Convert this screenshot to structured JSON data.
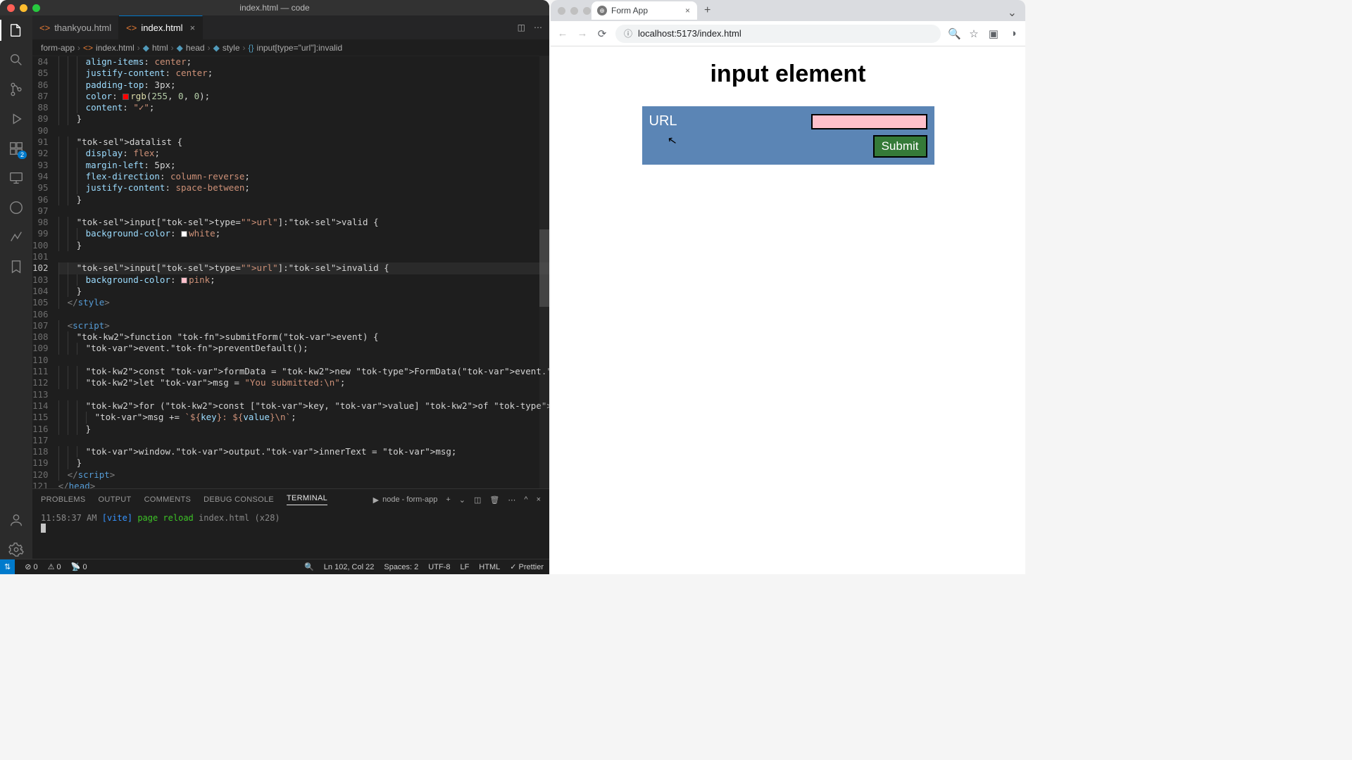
{
  "vscode": {
    "window_title": "index.html — code",
    "tabs": [
      {
        "label": "thankyou.html"
      },
      {
        "label": "index.html"
      }
    ],
    "tab_actions": {
      "split": "▯▯",
      "more": "⋯"
    },
    "breadcrumbs": {
      "items": [
        "form-app",
        "index.html",
        "html",
        "head",
        "style",
        "input[type=\"url\"]:invalid"
      ]
    },
    "code_lines": {
      "84": "      align-items: center;",
      "85": "      justify-content: center;",
      "86": "      padding-top: 3px;",
      "87": "      color: rgb(255, 0, 0);",
      "88": "      content: \"✓\";",
      "89": "    }",
      "90": "",
      "91": "    datalist {",
      "92": "      display: flex;",
      "93": "      margin-left: 5px;",
      "94": "      flex-direction: column-reverse;",
      "95": "      justify-content: space-between;",
      "96": "    }",
      "97": "",
      "98": "    input[type=\"url\"]:valid {",
      "99": "      background-color: white;",
      "100": "    }",
      "101": "",
      "102": "    input[type=\"url\"]:invalid {",
      "103": "      background-color: pink;",
      "104": "    }",
      "105": "  </style>",
      "106": "",
      "107": "  <script>",
      "108": "    function submitForm(event) {",
      "109": "      event.preventDefault();",
      "110": "",
      "111": "      const formData = new FormData(event.target);",
      "112": "      let msg = \"You submitted:\\n\";",
      "113": "",
      "114": "      for (const [key, value] of Array.from(formData)) {",
      "115": "        msg += `${key}: ${value}\\n`;",
      "116": "      }",
      "117": "",
      "118": "      window.output.innerText = msg;",
      "119": "    }",
      "120": "  </script>",
      "121": "</head>"
    },
    "panel": {
      "tabs": [
        "PROBLEMS",
        "OUTPUT",
        "COMMENTS",
        "DEBUG CONSOLE",
        "TERMINAL"
      ],
      "terminal_select": "node - form-app",
      "output": {
        "time": "11:58:37 AM",
        "tag": "[vite]",
        "msg": "page reload",
        "file": "index.html",
        "count": "(x28)"
      }
    },
    "statusbar": {
      "errors": "0",
      "warnings": "0",
      "ports": "0",
      "cursor": "Ln 102, Col 22",
      "spaces": "Spaces: 2",
      "encoding": "UTF-8",
      "eol": "LF",
      "lang": "HTML",
      "prettier": "Prettier"
    },
    "activity_badge": "2"
  },
  "browser": {
    "tab_title": "Form App",
    "url": "localhost:5173/index.html",
    "page": {
      "heading": "input element",
      "label": "URL",
      "submit": "Submit"
    }
  }
}
